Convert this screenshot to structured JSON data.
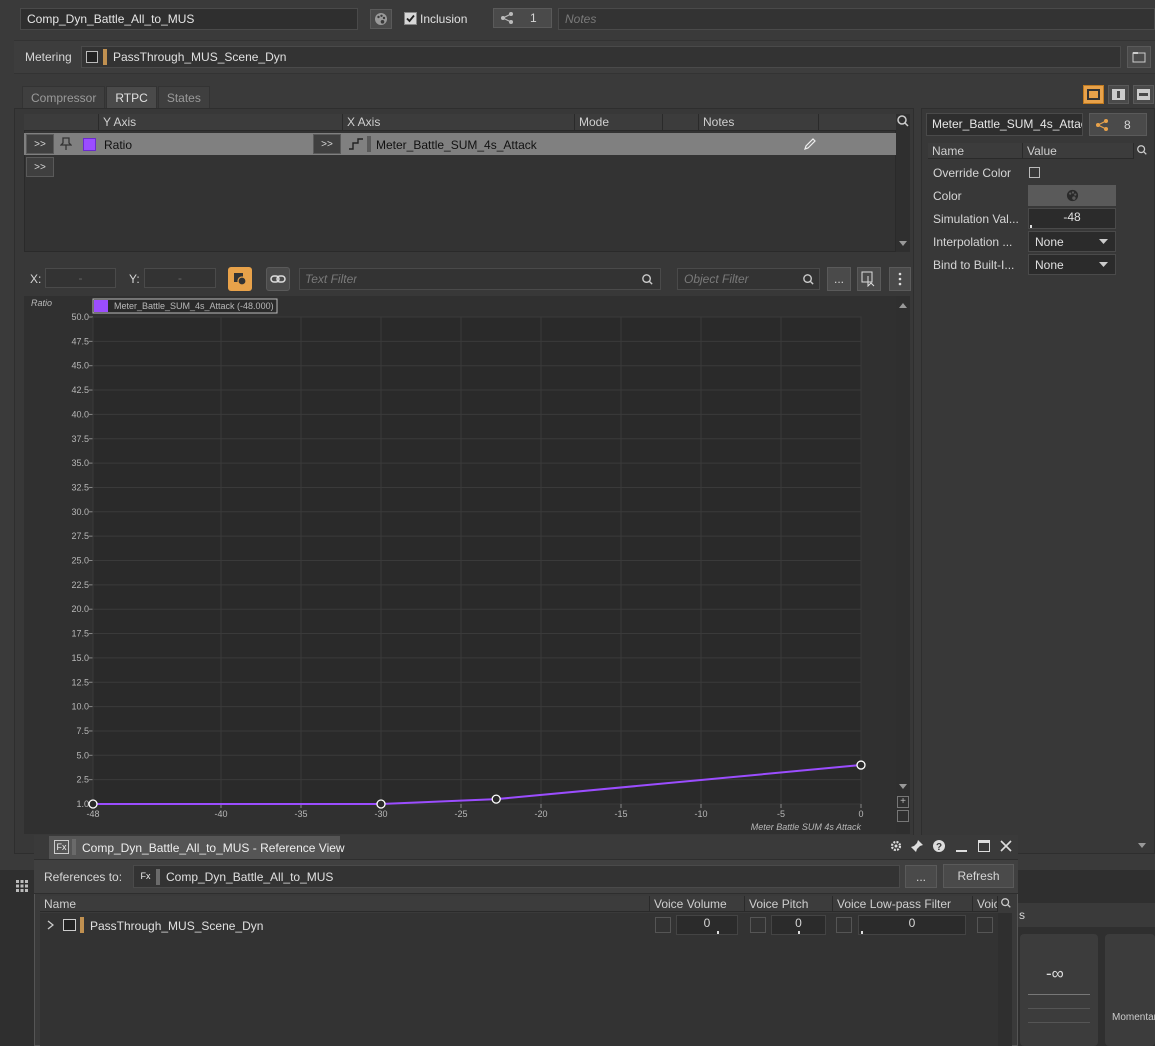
{
  "top": {
    "object_name": "Comp_Dyn_Battle_All_to_MUS",
    "inclusion_label": "Inclusion",
    "share_count": "1",
    "notes_placeholder": "Notes"
  },
  "metering": {
    "label": "Metering",
    "value": "PassThrough_MUS_Scene_Dyn"
  },
  "tabs": [
    {
      "label": "Compressor"
    },
    {
      "label": "RTPC"
    },
    {
      "label": "States"
    }
  ],
  "rtpc_table": {
    "headers": [
      "Y Axis",
      "X Axis",
      "Mode",
      "Notes"
    ],
    "row": {
      "expand1": ">>",
      "y_param": "Ratio",
      "expand2": ">>",
      "x_param": "Meter_Battle_SUM_4s_Attack"
    },
    "empty_row_expand": ">>"
  },
  "graph_toolbar": {
    "x_label": "X:",
    "x_value": "-",
    "y_label": "Y:",
    "y_value": "-",
    "text_filter_placeholder": "Text Filter",
    "object_filter_placeholder": "Object Filter",
    "more_label": "..."
  },
  "chart_data": {
    "type": "line",
    "ylabel": "Ratio",
    "xlabel": "Meter Battle SUM 4s Attack",
    "legend": "Meter_Battle_SUM_4s_Attack (-48.000)",
    "xlim": [
      -48,
      0
    ],
    "ylim": [
      1,
      50
    ],
    "x_ticks": [
      -48,
      -40,
      -35,
      -30,
      -25,
      -20,
      -15,
      -10,
      -5,
      0
    ],
    "y_ticks": [
      "50.0",
      "47.5",
      "45.0",
      "42.5",
      "40.0",
      "37.5",
      "35.0",
      "32.5",
      "30.0",
      "27.5",
      "25.0",
      "22.5",
      "20.0",
      "17.5",
      "15.0",
      "12.5",
      "10.0",
      "7.5",
      "5.0",
      "2.5",
      "1.0"
    ],
    "series": [
      {
        "name": "Meter_Battle_SUM_4s_Attack",
        "color": "#9b4dff",
        "points": [
          [
            -48,
            1.0
          ],
          [
            -30,
            1.0
          ],
          [
            -22.8,
            1.3
          ],
          [
            0,
            4.0
          ]
        ]
      }
    ],
    "grid": true
  },
  "properties": {
    "rtpc_name": "Meter_Battle_SUM_4s_Attac",
    "ref_count": "8",
    "headers": [
      "Name",
      "Value"
    ],
    "rows": [
      {
        "name": "Override Color",
        "value": ""
      },
      {
        "name": "Color",
        "value": ""
      },
      {
        "name": "Simulation Val...",
        "value": "-48"
      },
      {
        "name": "Interpolation ...",
        "value": "None"
      },
      {
        "name": "Bind to Built-I...",
        "value": "None"
      }
    ]
  },
  "reference_view": {
    "title": "Comp_Dyn_Battle_All_to_MUS - Reference View",
    "references_label": "References to:",
    "references_value": "Comp_Dyn_Battle_All_to_MUS",
    "more_label": "...",
    "refresh_label": "Refresh",
    "headers": [
      "Name",
      "Voice Volume",
      "Voice Pitch",
      "Voice Low-pass Filter",
      "Voic"
    ],
    "rows": [
      {
        "name": "PassThrough_MUS_Scene_Dyn",
        "volume": "0",
        "pitch": "0",
        "lpf": "0"
      }
    ]
  },
  "background_panel": {
    "tab_fragment": "s",
    "meter_value": "-∞",
    "meter_label": "Momentar"
  }
}
